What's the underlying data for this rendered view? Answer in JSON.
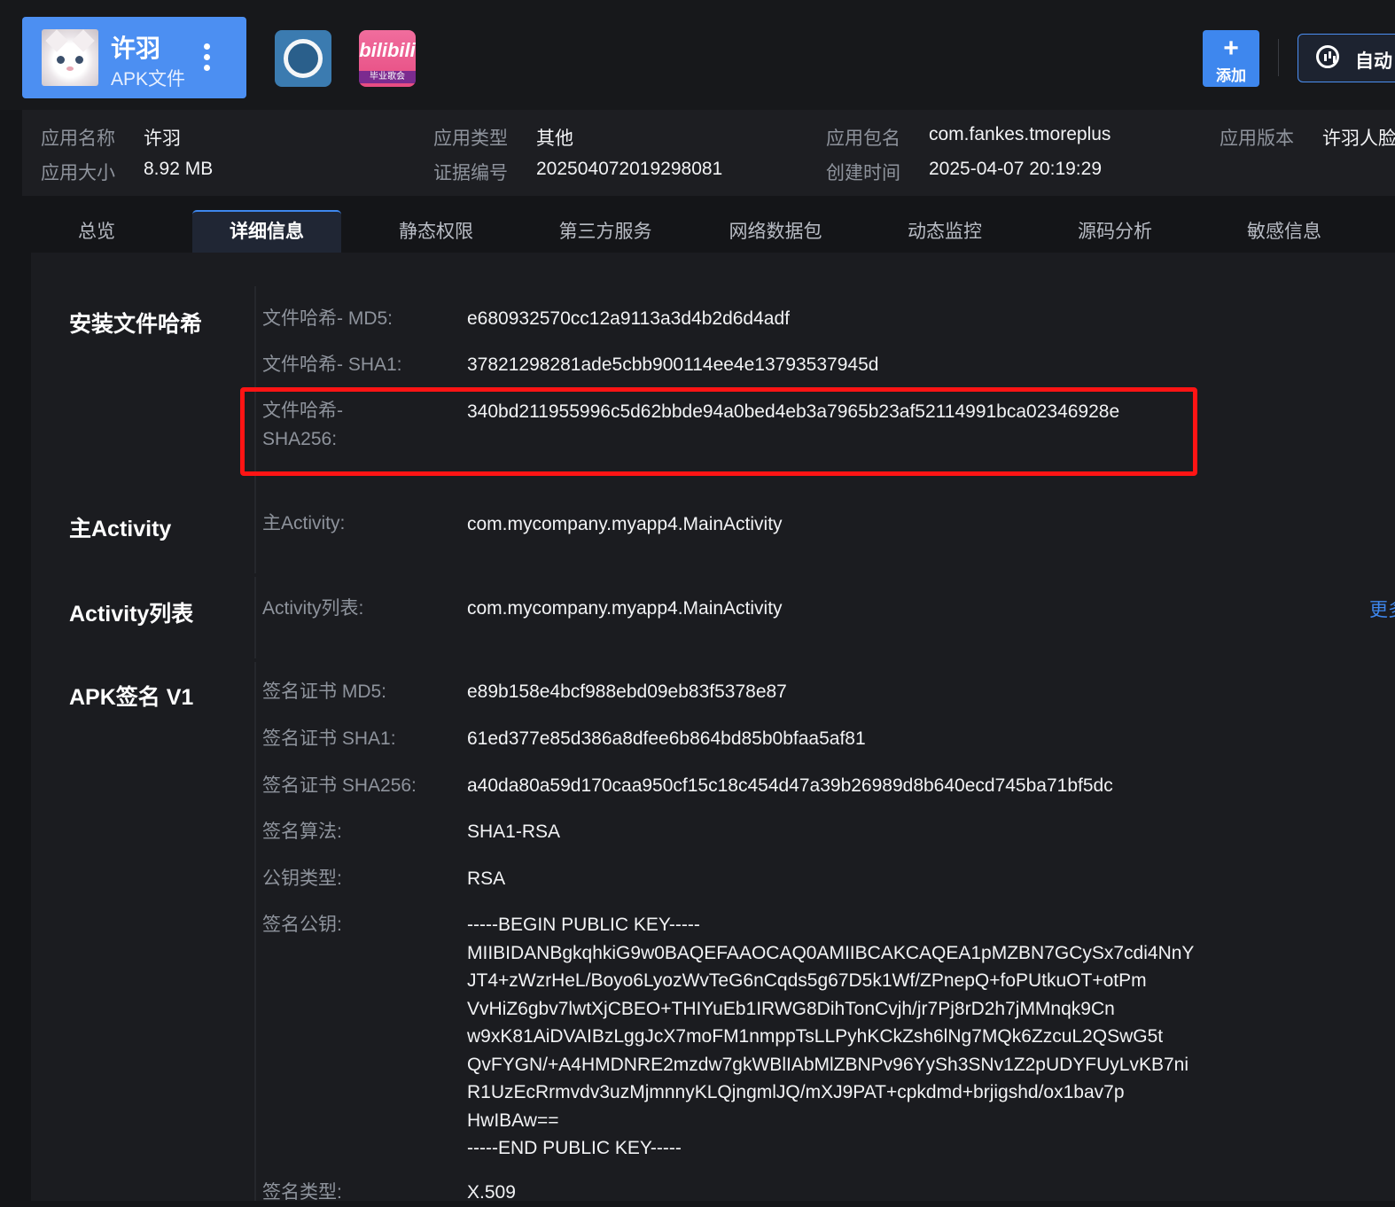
{
  "header": {
    "app_name": "许羽",
    "app_kind": "APK文件",
    "tile_2_logo": "bilibili",
    "tile_2_sub": "毕业歌会",
    "add_label": "添加",
    "auto_label": "自动"
  },
  "info": {
    "name_label": "应用名称",
    "name_value": "许羽",
    "size_label": "应用大小",
    "size_value": "8.92 MB",
    "type_label": "应用类型",
    "type_value": "其他",
    "cert_label": "证据编号",
    "cert_value": "20250407201929808​1",
    "pkg_label": "应用包名",
    "pkg_value": "com.fankes.tmoreplus",
    "time_label": "创建时间",
    "time_value": "2025-04-07 20:19:29",
    "ver_label": "应用版本",
    "ver_value": "许羽人脸"
  },
  "tabs": [
    "总览",
    "详细信息",
    "静态权限",
    "第三方服务",
    "网络数据包",
    "动态监控",
    "源码分析",
    "敏感信息"
  ],
  "sections": {
    "hash": {
      "title": "安装文件哈希",
      "md5_label": "文件哈希- MD5:",
      "md5_value": "e680932570cc12a9113a3d4b2d6d4adf",
      "sha1_label": "文件哈希- SHA1:",
      "sha1_value": "37821298281ade5cbb900114ee4e13793537945d",
      "sha256_label_1": "文件哈希-",
      "sha256_label_2": "SHA256:",
      "sha256_value": "340bd211955996c5d62bbde94a0bed4eb3a7965b23af52114991bca02346928e"
    },
    "main_activity": {
      "title": "主Activity",
      "label": "主Activity:",
      "value": "com.mycompany.myapp4.MainActivity"
    },
    "activity_list": {
      "title": "Activity列表",
      "label": "Activity列表:",
      "value": "com.mycompany.myapp4.MainActivity",
      "more": "更多"
    },
    "apk_sign": {
      "title": "APK签名 V1",
      "md5_label": "签名证书 MD5:",
      "md5_value": "e89b158e4bcf988ebd09eb83f5378e87",
      "sha1_label": "签名证书 SHA1:",
      "sha1_value": "61ed377e85d386a8dfee6b864bd85b0bfaa5af81",
      "sha256_label": "签名证书 SHA256:",
      "sha256_value": "a40da80a59d170caa950cf15c18c454d47a39b26989d8b640ecd745ba71bf5dc",
      "algo_label": "签名算法:",
      "algo_value": "SHA1-RSA",
      "keytype_label": "公钥类型:",
      "keytype_value": "RSA",
      "pubkey_label": "签名公钥:",
      "pubkey_lines": [
        "-----BEGIN PUBLIC KEY-----",
        "MIIBIDANBgkqhkiG9w0BAQEFAAOCAQ0AMIIBCAKCAQEA1pMZBN7GCySx7cdi4NnY",
        "JT4+zWzrHeL/Boyo6LyozWvTeG6nCqds5g67D5k1Wf/ZPnepQ+foPUtkuOT+otPm",
        "VvHiZ6gbv7lwtXjCBEO+THIYuEb1IRWG8DihTonCvjh/jr7Pj8rD2h7jMMnqk9Cn",
        "w9xK81AiDVAIBzLggJcX7moFM1nmppTsLLPyhKCkZsh6lNg7MQk6ZzcuL2QSwG5t",
        "QvFYGN/+A4HMDNRE2mzdw7gkWBlIAbMlZBNPv96YySh3SNv1Z2pUDYFUyLvKB7ni",
        "R1UzEcRrmvdv3uzMjmnnyKLQjngmlJQ/mXJ9PAT+cpkdmd+brjigshd/ox1bav7p",
        "HwIBAw==",
        "-----END PUBLIC KEY-----"
      ],
      "signtype_label": "签名类型:",
      "signtype_value": "X.509"
    }
  }
}
